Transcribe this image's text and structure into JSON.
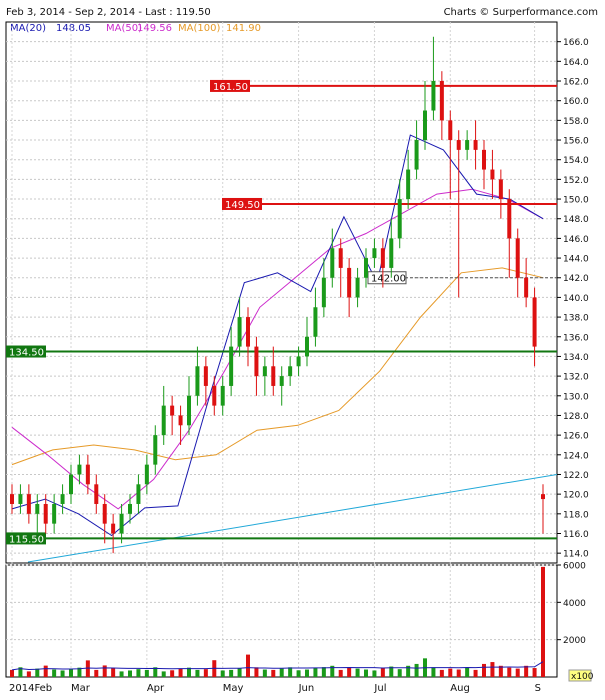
{
  "header": {
    "range_text": "Feb 3, 2014 - Sep 2, 2014 - Last : 119.50",
    "credit": "Charts © Surperformance.com"
  },
  "legend": [
    {
      "label": "MA(20)",
      "value": "148.05",
      "color": "#1a1ab0"
    },
    {
      "label": "MA(50)",
      "value": "149.56",
      "color": "#cc2ccc"
    },
    {
      "label": "MA(100)",
      "value": "141.90",
      "color": "#e69a28"
    }
  ],
  "colors": {
    "up": "#1a9a1a",
    "down": "#dd1111",
    "trend": "#20a8d8",
    "support": "#117711",
    "resistance": "#dd1111",
    "pivot": "#444444"
  },
  "chart_data": {
    "type": "candlestick",
    "title": "Feb 3, 2014 - Sep 2, 2014 - Last : 119.50",
    "ylim": [
      113,
      168
    ],
    "y_ticks": [
      114,
      116,
      118,
      120,
      122,
      124,
      126,
      128,
      130,
      132,
      134,
      136,
      138,
      140,
      142,
      144,
      146,
      148,
      150,
      152,
      154,
      156,
      158,
      160,
      162,
      164,
      166
    ],
    "x_labels": [
      "2014Feb",
      "Mar",
      "Apr",
      "May",
      "Jun",
      "Jul",
      "Aug",
      "S"
    ],
    "volume_ticks": [
      {
        "value": 2000,
        "label": "2000"
      },
      {
        "value": 4000,
        "label": "4000"
      },
      {
        "value": 6000,
        "label": "6000"
      }
    ],
    "volume_unit": "x100",
    "volume_max": 6000,
    "levels": [
      {
        "value": 161.5,
        "label": "161.50",
        "kind": "resistance"
      },
      {
        "value": 149.5,
        "label": "149.50",
        "kind": "resistance"
      },
      {
        "value": 142.0,
        "label": "142.00",
        "kind": "pivot"
      },
      {
        "value": 134.5,
        "label": "134.50",
        "kind": "support"
      },
      {
        "value": 115.5,
        "label": "115.50",
        "kind": "support"
      }
    ],
    "trendline": {
      "start": 113.1,
      "end": 122.0
    },
    "ma20": [
      118.5,
      119.5,
      118.0,
      115.8,
      118.6,
      118.8,
      130.5,
      141.5,
      142.5,
      140.6,
      148.2,
      141.5,
      156.5,
      155.0,
      150.5,
      150.0,
      148.0
    ],
    "ma50": [
      126.8,
      124.0,
      121.0,
      118.5,
      121.5,
      126.5,
      132.5,
      139.0,
      142.0,
      145.0,
      146.5,
      148.5,
      150.5,
      151.0,
      150.0,
      148.0
    ],
    "ma100": [
      123.0,
      124.5,
      125.0,
      124.5,
      123.5,
      124.0,
      126.5,
      127.0,
      128.5,
      132.5,
      138.0,
      142.5,
      143.0,
      142.0
    ],
    "candles": [
      [
        120,
        119,
        121,
        118
      ],
      [
        119,
        120,
        121,
        118
      ],
      [
        120,
        118,
        121,
        117
      ],
      [
        118,
        119,
        120,
        116
      ],
      [
        119,
        117,
        120,
        116
      ],
      [
        117,
        119,
        120,
        116
      ],
      [
        119,
        120,
        121,
        118
      ],
      [
        120,
        122,
        123,
        119
      ],
      [
        122,
        123,
        124,
        121
      ],
      [
        123,
        121,
        124,
        120
      ],
      [
        121,
        119,
        122,
        118
      ],
      [
        119,
        117,
        120,
        115
      ],
      [
        117,
        116,
        118,
        114
      ],
      [
        116,
        118,
        119,
        115
      ],
      [
        118,
        119,
        120,
        117
      ],
      [
        119,
        121,
        122,
        118
      ],
      [
        121,
        123,
        124,
        120
      ],
      [
        123,
        126,
        127,
        122
      ],
      [
        126,
        129,
        131,
        125
      ],
      [
        129,
        128,
        130,
        126
      ],
      [
        128,
        127,
        129,
        125
      ],
      [
        127,
        130,
        132,
        126
      ],
      [
        130,
        133,
        135,
        129
      ],
      [
        133,
        131,
        134,
        129
      ],
      [
        131,
        129,
        132,
        128
      ],
      [
        129,
        131,
        132,
        128
      ],
      [
        131,
        135,
        137,
        130
      ],
      [
        135,
        138,
        140,
        134
      ],
      [
        138,
        135,
        139,
        133
      ],
      [
        135,
        132,
        136,
        130
      ],
      [
        132,
        133,
        134,
        130
      ],
      [
        133,
        131,
        135,
        130
      ],
      [
        131,
        132,
        133,
        129
      ],
      [
        132,
        133,
        134,
        131
      ],
      [
        133,
        134,
        135,
        132
      ],
      [
        134,
        136,
        138,
        133
      ],
      [
        136,
        139,
        141,
        135
      ],
      [
        139,
        142,
        144,
        138
      ],
      [
        142,
        145,
        147,
        141
      ],
      [
        145,
        143,
        146,
        140
      ],
      [
        143,
        140,
        144,
        138
      ],
      [
        140,
        142,
        143,
        139
      ],
      [
        142,
        144,
        145,
        141
      ],
      [
        144,
        145,
        146,
        143
      ],
      [
        145,
        143,
        146,
        141
      ],
      [
        143,
        146,
        148,
        142
      ],
      [
        146,
        150,
        152,
        145
      ],
      [
        150,
        153,
        155,
        149
      ],
      [
        153,
        156,
        158,
        152
      ],
      [
        156,
        159,
        162,
        155
      ],
      [
        159,
        162,
        166.5,
        158
      ],
      [
        162,
        158,
        163,
        156
      ],
      [
        158,
        156,
        159,
        150
      ],
      [
        156,
        155,
        157,
        140
      ],
      [
        155,
        156,
        157,
        154
      ],
      [
        156,
        155,
        158,
        153
      ],
      [
        155,
        153,
        156,
        151
      ],
      [
        153,
        152,
        155,
        150
      ],
      [
        152,
        150,
        153,
        148
      ],
      [
        150,
        146,
        151,
        142
      ],
      [
        146,
        142,
        147,
        140
      ],
      [
        142,
        140,
        144,
        139
      ],
      [
        140,
        135,
        141,
        133
      ],
      [
        120,
        119.5,
        121,
        116
      ]
    ],
    "volumes": [
      380,
      520,
      300,
      450,
      610,
      400,
      350,
      420,
      500,
      890,
      380,
      620,
      460,
      300,
      350,
      420,
      380,
      520,
      300,
      360,
      450,
      500,
      380,
      420,
      900,
      350,
      380,
      460,
      1200,
      520,
      400,
      380,
      450,
      520,
      360,
      400,
      480,
      530,
      600,
      380,
      520,
      450,
      400,
      350,
      480,
      560,
      420,
      600,
      700,
      1000,
      520,
      380,
      450,
      400,
      520,
      380,
      700,
      800,
      600,
      500,
      450,
      600,
      480,
      5900
    ]
  }
}
